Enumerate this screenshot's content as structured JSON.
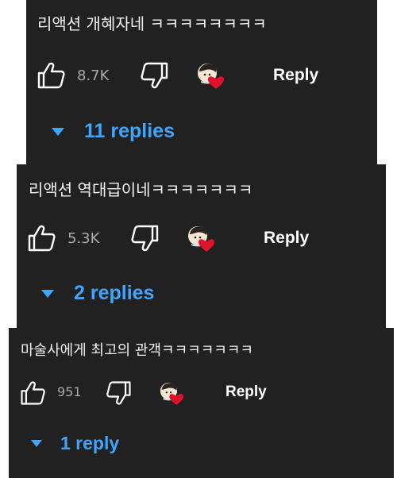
{
  "colors": {
    "panel_bg": "#212121",
    "text": "#f1f1f1",
    "count": "#aaaaaa",
    "link": "#3ea6ff",
    "heart": "#e0122b"
  },
  "icons": {
    "like": "thumbs-up-icon",
    "dislike": "thumbs-down-icon",
    "heart": "creator-heart-icon",
    "expand": "caret-down-icon"
  },
  "comments": [
    {
      "text": "리액션 개혜자네 ㅋㅋㅋㅋㅋㅋㅋㅋ",
      "likes": "8.7K",
      "reply_label": "Reply",
      "replies_label": "11 replies"
    },
    {
      "text": "리액션 역대급이네ㅋㅋㅋㅋㅋㅋㅋ",
      "likes": "5.3K",
      "reply_label": "Reply",
      "replies_label": "2 replies"
    },
    {
      "text": "마술사에게 최고의 관객ㅋㅋㅋㅋㅋㅋㅋ",
      "likes": "951",
      "reply_label": "Reply",
      "replies_label": "1 reply"
    }
  ]
}
